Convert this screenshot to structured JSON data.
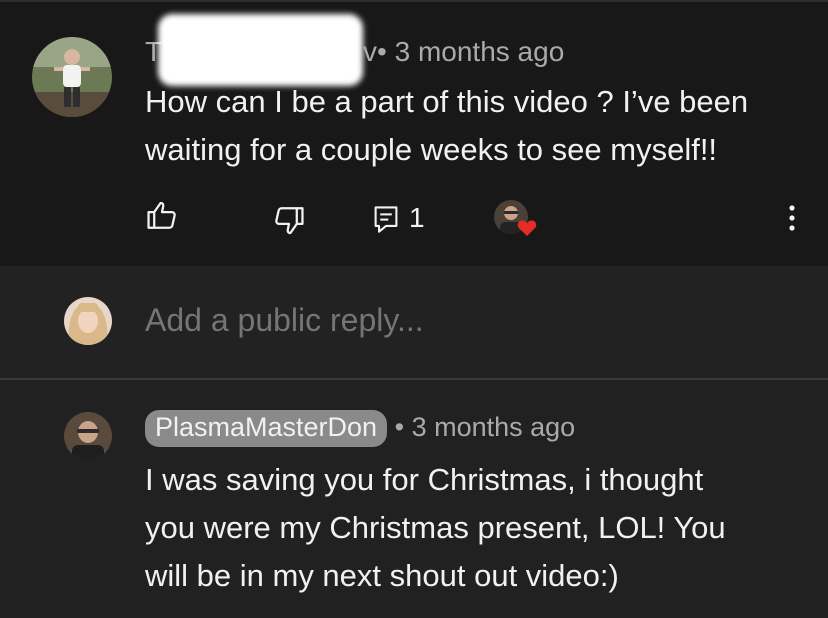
{
  "top_comment": {
    "author_visible_fragment_start": "T",
    "author_visible_fragment_end": "v",
    "separator": "•",
    "time": "3 months ago",
    "text_lines": [
      "How can I be a part of this video ? I’ve been",
      "waiting for a couple weeks to see myself!!"
    ],
    "reply_count": "1",
    "icons": {
      "like": "thumbs-up-icon",
      "dislike": "thumbs-down-icon",
      "reply": "reply-icon",
      "heart": "creator-heart-icon",
      "more": "more-vertical-icon"
    },
    "heart_color": "#e52d27"
  },
  "reply_box": {
    "placeholder": "Add a public reply..."
  },
  "reply_comment": {
    "author": "PlasmaMasterDon",
    "separator": "•",
    "time": "3 months ago",
    "text_lines": [
      "I was saving you for Christmas, i thought",
      "you were my Christmas present, LOL! You",
      "will be in my next shout out video:)"
    ]
  }
}
